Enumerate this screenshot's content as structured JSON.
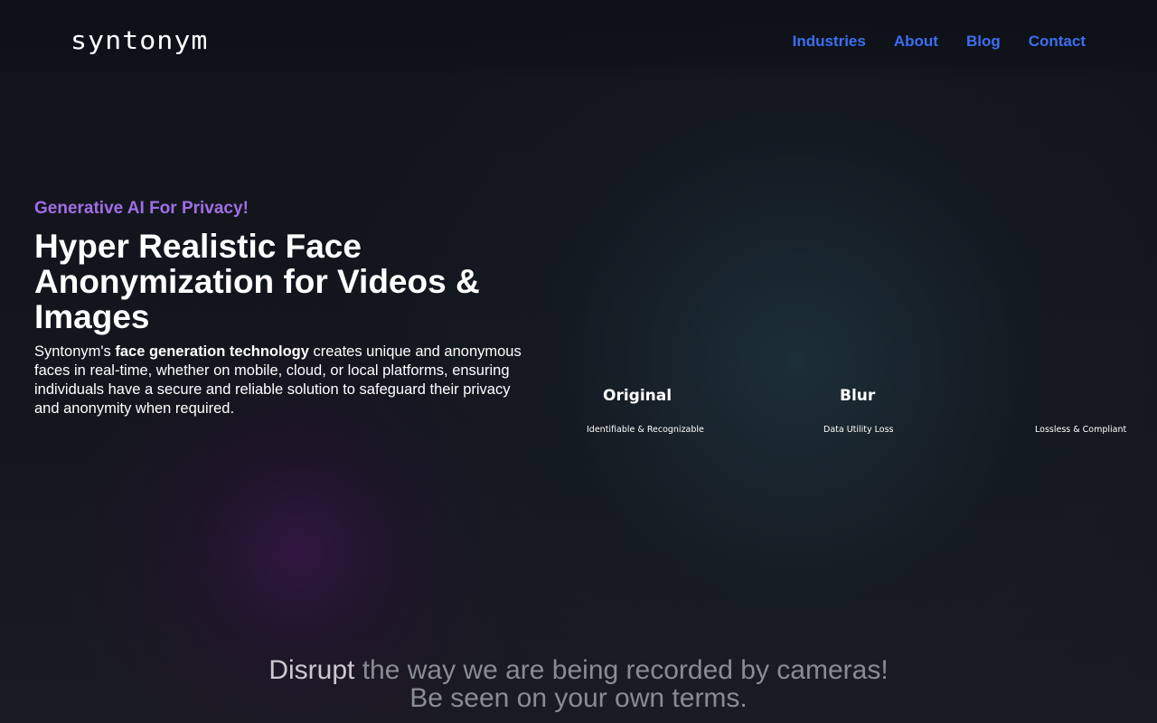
{
  "header": {
    "logo": "syntonym",
    "nav": [
      {
        "label": "Industries"
      },
      {
        "label": "About"
      },
      {
        "label": "Blog"
      },
      {
        "label": "Contact"
      }
    ]
  },
  "hero": {
    "eyebrow": "Generative AI For Privacy!",
    "headline": "Hyper Realistic Face Anonymization for Videos & Images",
    "body_prefix": "Syntonym's ",
    "body_bold": "face generation technology",
    "body_suffix": " creates unique and anonymous faces in real-time, whether on mobile, cloud, or local platforms, ensuring individuals have a secure and reliable solution to safeguard their privacy and anonymity when required."
  },
  "comparison": {
    "items": [
      {
        "label": "Original",
        "caption": "Identifiable & Recognizable"
      },
      {
        "label": "Blur",
        "caption": "Data Utility Loss"
      },
      {
        "label": "",
        "caption": "Lossless & Compliant"
      }
    ]
  },
  "tagline": {
    "highlight": "Disrupt",
    "line1_rest": " the way we are being recorded by cameras!",
    "line2": "Be seen on your own terms."
  },
  "colors": {
    "background": "#0f1118",
    "nav_link": "#3b6ff0",
    "eyebrow": "#a06ee6",
    "tagline_muted": "#8a8c94"
  }
}
